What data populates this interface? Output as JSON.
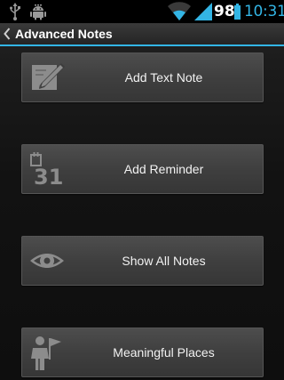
{
  "status_bar": {
    "battery_level": "98",
    "time": "10:31",
    "icons": [
      "usb-icon",
      "android-debug-icon",
      "wifi-icon",
      "signal-icon",
      "battery-icon"
    ],
    "clock_color": "#33b5e5"
  },
  "action_bar": {
    "title": "Advanced Notes",
    "back_icon": "chevron-left-icon",
    "accent_color": "#33b5e5"
  },
  "menu": {
    "items": [
      {
        "label": "Add Text Note",
        "icon": "edit-note-icon"
      },
      {
        "label": "Add Reminder",
        "icon": "calendar-31-icon",
        "icon_text": "31"
      },
      {
        "label": "Show All Notes",
        "icon": "eye-icon"
      },
      {
        "label": "Meaningful Places",
        "icon": "person-flag-icon"
      }
    ]
  }
}
